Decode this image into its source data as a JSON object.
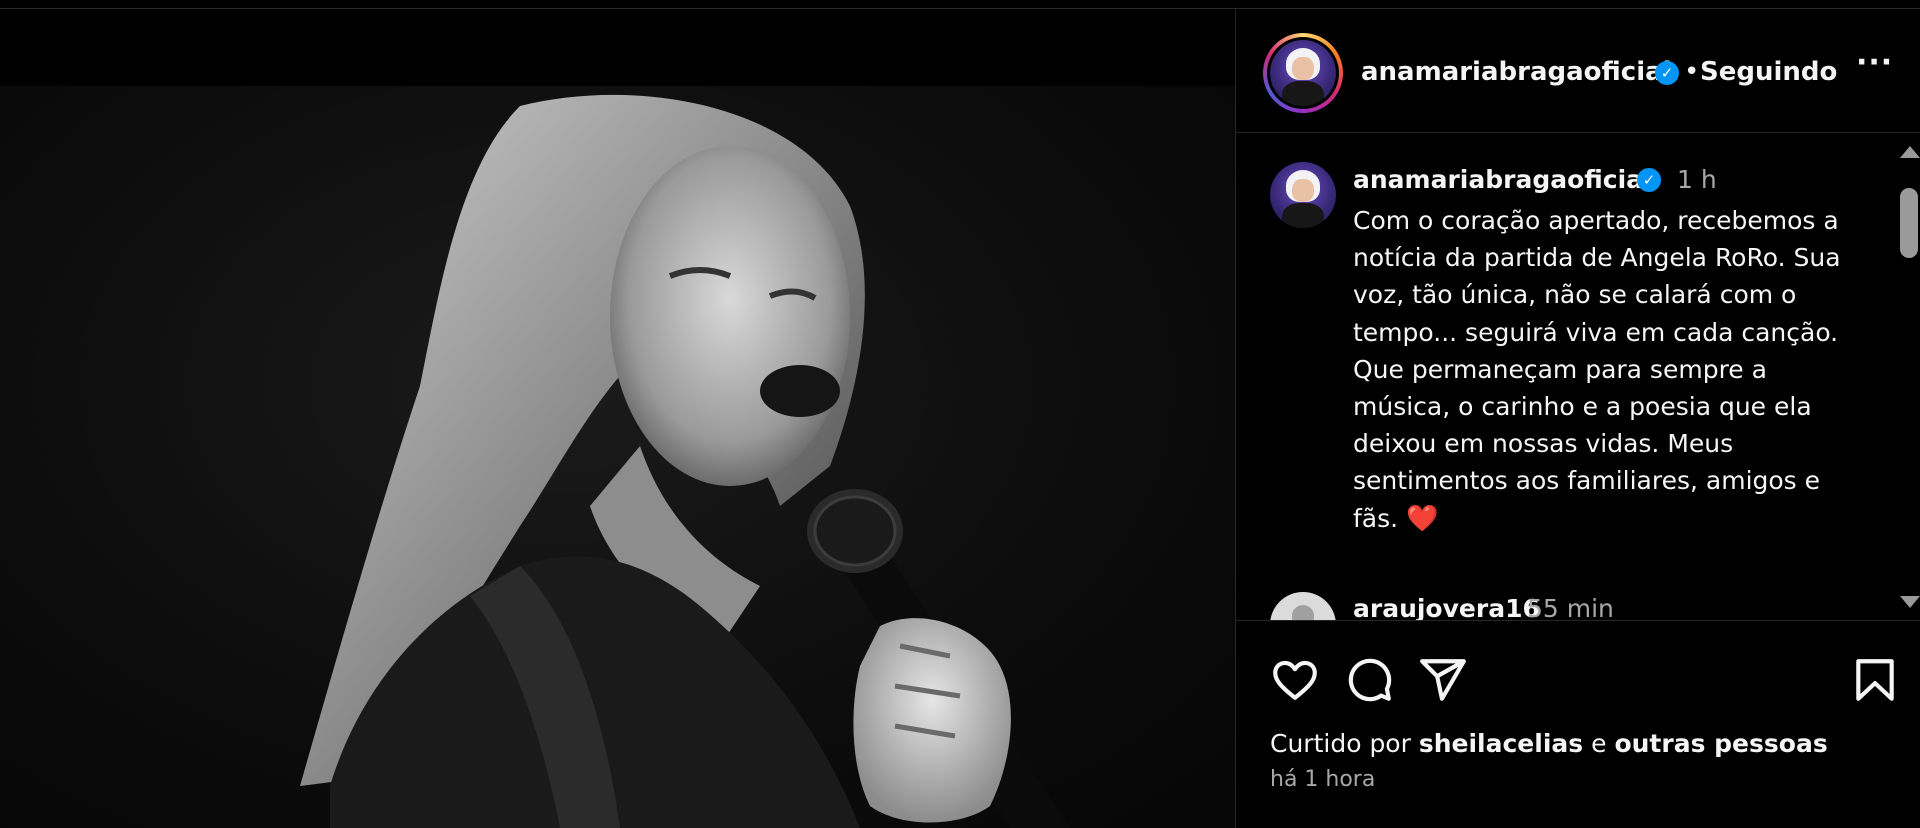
{
  "post": {
    "username": "anamariabragaoficial",
    "verified_mark": "✓",
    "dot": "•",
    "follow_status": "Seguindo",
    "more_label": "···"
  },
  "caption": {
    "username": "anamariabragaoficial",
    "time": "1 h",
    "text": "Com o coração apertado, recebemos a\nnotícia da partida de Angela RoRo. Sua\nvoz, tão única, não se calará com o\ntempo... seguirá viva em cada canção.\nQue permaneçam para sempre a\nmúsica, o carinho e a poesia que ela\ndeixou em nossas vidas. Meus\nsentimentos aos familiares, amigos e\nfãs.",
    "emoji": "❤️"
  },
  "comments": [
    {
      "username": "araujovera16",
      "time": "55 min"
    }
  ],
  "actions": {
    "icons": [
      "heart-icon",
      "comment-icon",
      "share-icon",
      "bookmark-icon"
    ]
  },
  "likes": {
    "prefix": "Curtido por",
    "user": "sheilacelias",
    "conjunction": "e",
    "others": "outras pessoas"
  },
  "posted_ago": "há 1 hora",
  "colors": {
    "background": "#000000",
    "text": "#f5f5f5",
    "muted": "#a8a8a8",
    "verified": "#0095f6",
    "divider": "#262626"
  }
}
